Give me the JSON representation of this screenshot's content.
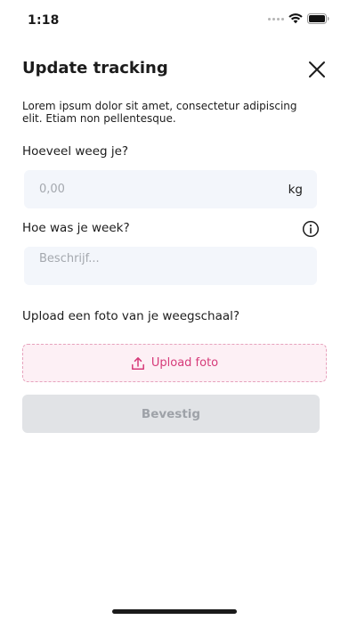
{
  "status_bar": {
    "time": "1:18",
    "icons": [
      "signal-dots-icon",
      "wifi-icon",
      "battery-icon"
    ]
  },
  "header": {
    "title": "Update tracking",
    "close_icon": "close-icon"
  },
  "description": "Lorem ipsum dolor sit amet, consectetur adipiscing elit. Etiam non pellentesque.",
  "weight": {
    "label": "Hoeveel weeg je?",
    "placeholder": "0,00",
    "value": "",
    "unit": "kg"
  },
  "week": {
    "label": "Hoe was je week?",
    "placeholder": "Beschrijf...",
    "value": "",
    "info_icon": "info-icon"
  },
  "upload": {
    "label": "Upload een foto van je weegschaal?",
    "button_label": "Upload foto",
    "icon": "upload-icon"
  },
  "confirm": {
    "label": "Bevestig",
    "state": "disabled"
  },
  "colors": {
    "accent": "#d63a79",
    "upload_bg": "#fdf0f5",
    "upload_border": "#e7a3bd",
    "field_bg": "#f3f6fb",
    "button_disabled_bg": "#e1e3e6",
    "button_disabled_text": "#9ea2a8"
  }
}
